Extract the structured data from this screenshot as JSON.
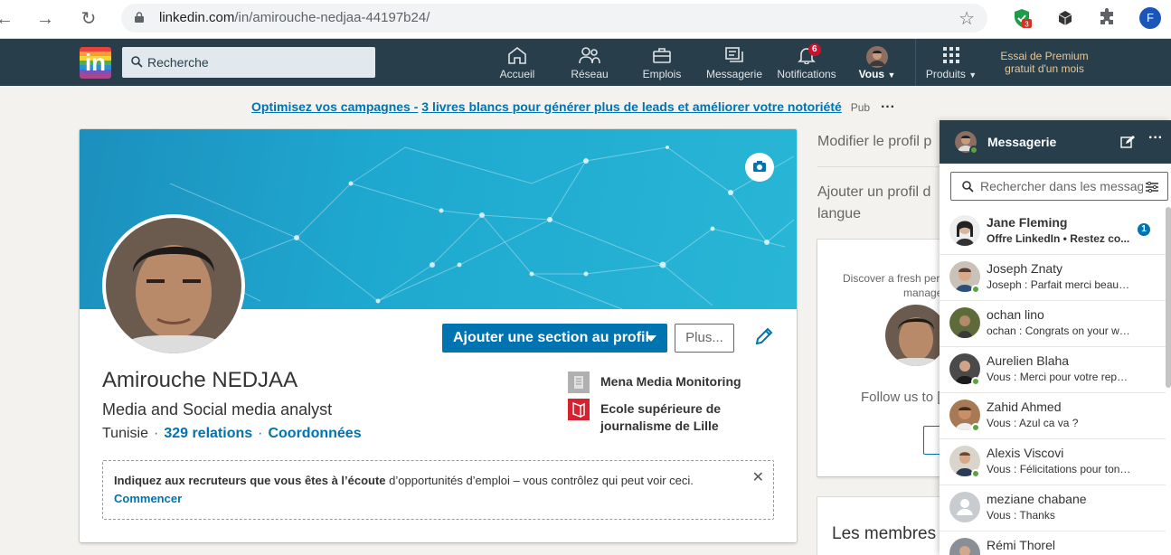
{
  "browser": {
    "url_host": "linkedin.com",
    "url_path": "/in/amirouche-nedjaa-44197b24/",
    "extension_badge": "3",
    "profile_initial": "F"
  },
  "nav": {
    "search_placeholder": "Recherche",
    "items": [
      {
        "label": "Accueil",
        "icon": "home-icon"
      },
      {
        "label": "Réseau",
        "icon": "network-icon"
      },
      {
        "label": "Emplois",
        "icon": "jobs-icon"
      },
      {
        "label": "Messagerie",
        "icon": "messaging-icon"
      },
      {
        "label": "Notifications",
        "icon": "bell-icon",
        "badge": "6"
      },
      {
        "label": "Vous",
        "icon": "me-avatar"
      },
      {
        "label": "Produits",
        "icon": "grid-icon"
      }
    ],
    "premium_line1": "Essai de Premium",
    "premium_line2": "gratuit d'un mois"
  },
  "ad": {
    "link": "Optimisez vos campagnes -",
    "text": "3 livres blancs pour générer plus de leads et améliorer votre notoriété",
    "pub": "Pub",
    "menu": "···"
  },
  "profile": {
    "add_section": "Ajouter une section au profil",
    "more": "Plus...",
    "name": "Amirouche NEDJAA",
    "headline": "Media and Social media analyst",
    "location": "Tunisie",
    "connections": "329 relations",
    "contact": "Coordonnées",
    "sep": "·",
    "experience": [
      {
        "name": "Mena Media Monitoring"
      },
      {
        "name": "Ecole supérieure de journalisme de Lille"
      }
    ],
    "open_to_work_bold": "Indiquez aux recruteurs que vous êtes à l’écoute",
    "open_to_work_rest": " d’opportunités d’emploi – vous contrôlez qui peut voir ceci.",
    "open_to_work_cta": "Commencer",
    "close": "✕"
  },
  "rail": {
    "edit_profile": "Modifier le profil p",
    "add_lang_1": "Ajouter un profil d",
    "add_lang_2": "langue",
    "discover_1": "Discover a fresh per",
    "discover_2": "manage",
    "follow": "Follow us to [",
    "members": "Les membres"
  },
  "messaging": {
    "title": "Messagerie",
    "more": "···",
    "search_placeholder": "Rechercher dans les messages",
    "conversations": [
      {
        "name": "Jane Fleming",
        "preview": "Offre LinkedIn •  Restez co...",
        "unread": "1",
        "online": false
      },
      {
        "name": "Joseph Znaty",
        "preview": "Joseph : Parfait merci beaucou...",
        "online": true
      },
      {
        "name": "ochan lino",
        "preview": "ochan : Congrats on your work ...",
        "online": false
      },
      {
        "name": "Aurelien Blaha",
        "preview": "Vous : Merci pour votre repons...",
        "online": true
      },
      {
        "name": "Zahid Ahmed",
        "preview": "Vous : Azul ca va ?",
        "online": true
      },
      {
        "name": "Alexis Viscovi",
        "preview": "Vous : Félicitations pour ton no...",
        "online": true
      },
      {
        "name": "meziane chabane",
        "preview": "Vous : Thanks",
        "online": false
      },
      {
        "name": "Rémi Thorel",
        "preview": "",
        "online": false
      }
    ]
  },
  "colors": {
    "linkedin_blue": "#0073b1",
    "nav_bg": "#283e4a",
    "premium_gold": "#e5c89b",
    "online_green": "#5aa33e"
  }
}
